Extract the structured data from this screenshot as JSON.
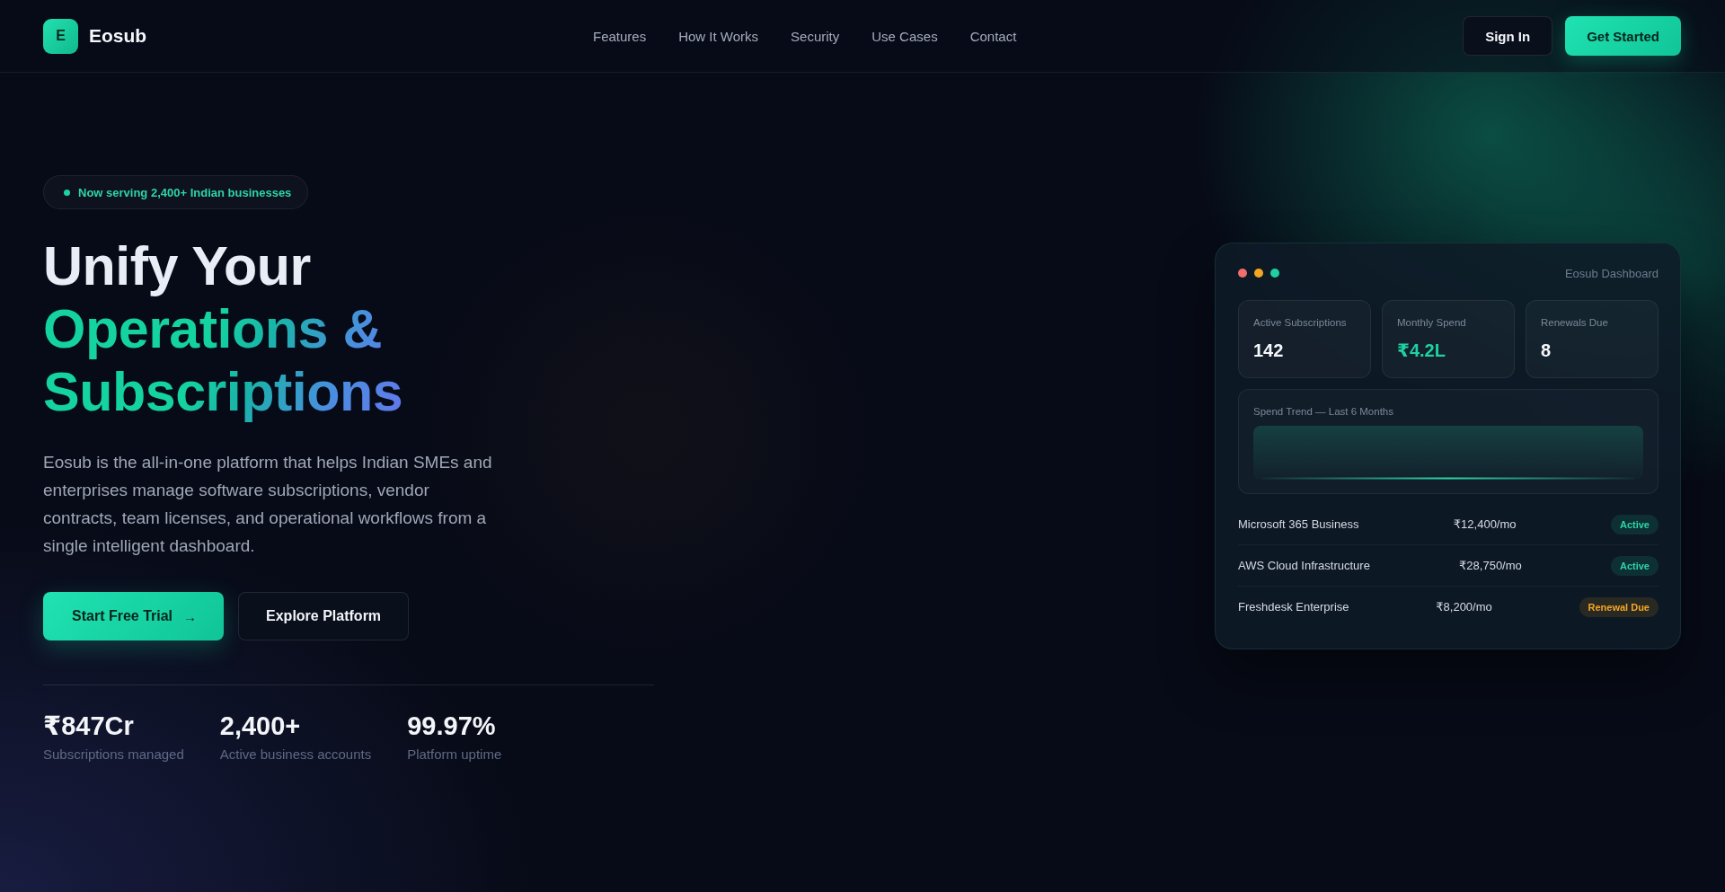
{
  "header": {
    "logo": {
      "mark": "E",
      "name": "Eosub"
    },
    "nav": [
      "Features",
      "How It Works",
      "Security",
      "Use Cases",
      "Contact"
    ],
    "actions": [
      {
        "label": "Sign In",
        "kind": "outline"
      },
      {
        "label": "Get Started",
        "kind": "primary"
      }
    ]
  },
  "hero": {
    "badge": "Now serving 2,400+ Indian businesses",
    "headline": {
      "plain": "Unify Your",
      "accent": "Operations & Subscriptions"
    },
    "description": "Eosub is the all-in-one platform that helps Indian SMEs and enterprises manage software subscriptions, vendor contracts, team licenses, and operational workflows from a single intelligent dashboard.",
    "buttons": [
      {
        "label": "Start Free Trial",
        "icon": "→",
        "kind": "primary"
      },
      {
        "label": "Explore Platform",
        "kind": "outline"
      }
    ],
    "stats": [
      {
        "value": "₹847Cr",
        "label": "Subscriptions managed"
      },
      {
        "value": "2,400+",
        "label": "Active business accounts"
      },
      {
        "value": "99.97%",
        "label": "Platform uptime"
      }
    ]
  },
  "dashboard": {
    "window_dots": [
      {
        "color": "#f26d6d"
      },
      {
        "color": "#f5a524"
      },
      {
        "color": "#1fd1a0"
      }
    ],
    "title": "Eosub Dashboard",
    "metrics": [
      {
        "label": "Active Subscriptions",
        "value": "142",
        "highlight": false
      },
      {
        "label": "Monthly Spend",
        "value": "₹4.2L",
        "highlight": true
      },
      {
        "label": "Renewals Due",
        "value": "8",
        "highlight": false
      }
    ],
    "trend": {
      "title": "Spend Trend — Last 6 Months"
    },
    "subscriptions": [
      {
        "name": "Microsoft 365 Business",
        "price": "₹12,400/mo",
        "status": "Active",
        "kind": "active"
      },
      {
        "name": "AWS Cloud Infrastructure",
        "price": "₹28,750/mo",
        "status": "Active",
        "kind": "active"
      },
      {
        "name": "Freshdesk Enterprise",
        "price": "₹8,200/mo",
        "status": "Renewal Due",
        "kind": "renewal"
      }
    ]
  }
}
